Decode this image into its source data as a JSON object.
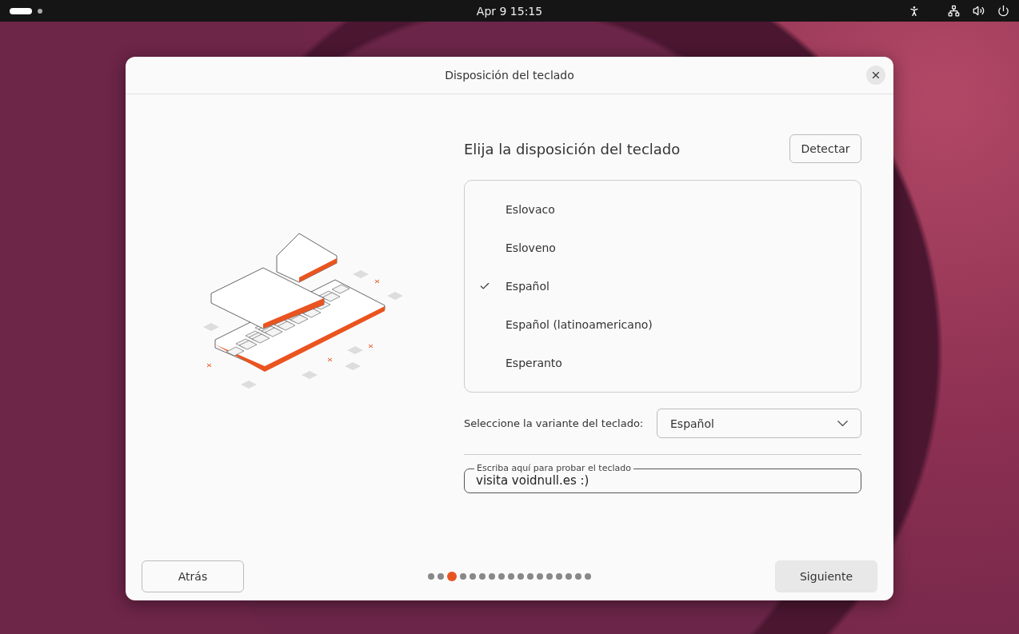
{
  "top_bar": {
    "clock": "Apr 9  15:15"
  },
  "dialog": {
    "title": "Disposición del teclado",
    "heading": "Elija la disposición del teclado",
    "detect_button": "Detectar",
    "layouts": [
      {
        "label": "Eslovaco",
        "selected": false
      },
      {
        "label": "Esloveno",
        "selected": false
      },
      {
        "label": "Español",
        "selected": true
      },
      {
        "label": "Español (latinoamericano)",
        "selected": false
      },
      {
        "label": "Esperanto",
        "selected": false
      }
    ],
    "variant_label": "Seleccione la variante del teclado:",
    "variant_value": "Español",
    "test_field": {
      "label": "Escriba aquí para probar el teclado",
      "value": "visita voidnull.es :)"
    },
    "back_button": "Atrás",
    "next_button": "Siguiente",
    "steps": [
      {
        "selected": false
      },
      {
        "selected": false
      },
      {
        "selected": true
      },
      {
        "selected": false
      },
      {
        "selected": false
      },
      {
        "selected": false
      },
      {
        "selected": false
      },
      {
        "selected": false
      },
      {
        "selected": false
      },
      {
        "selected": false
      },
      {
        "selected": false
      },
      {
        "selected": false
      },
      {
        "selected": false
      },
      {
        "selected": false
      },
      {
        "selected": false
      },
      {
        "selected": false
      },
      {
        "selected": false
      }
    ]
  }
}
